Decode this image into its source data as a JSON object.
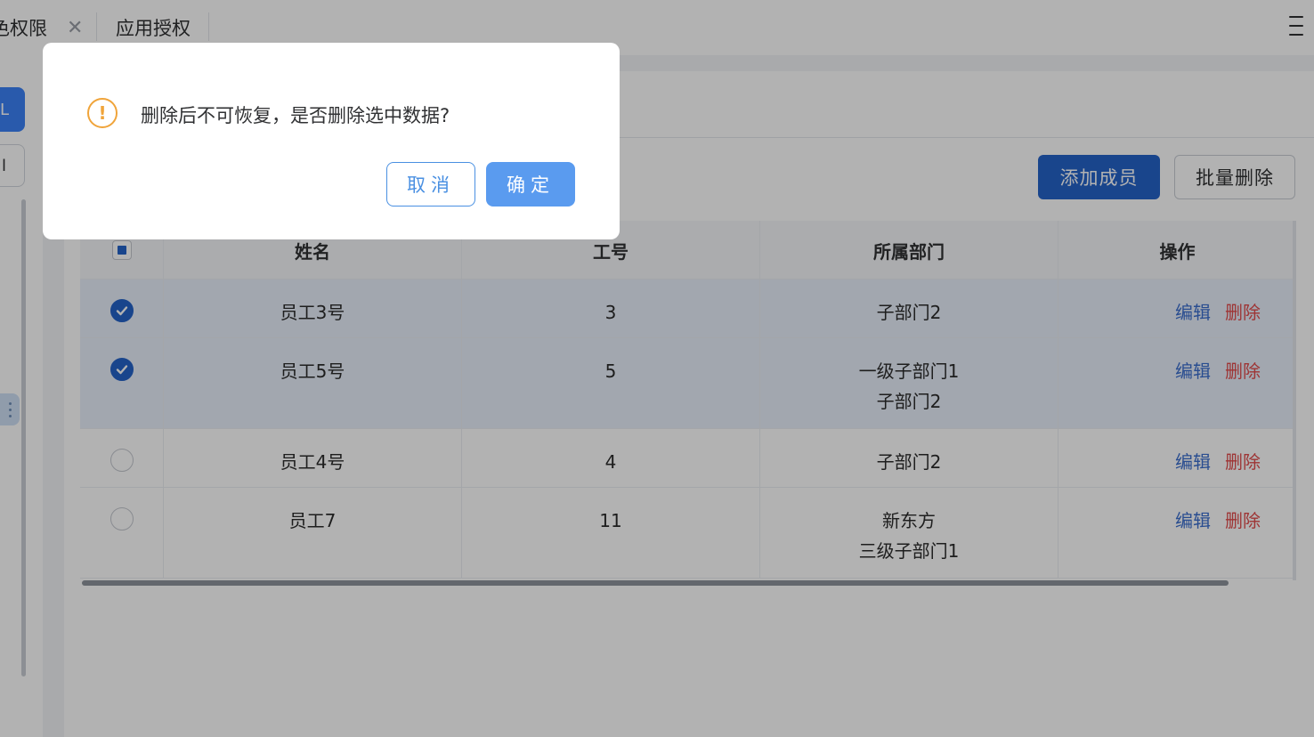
{
  "tabs": [
    {
      "label": "色权限",
      "closable": true
    },
    {
      "label": "应用授权",
      "closable": false
    }
  ],
  "icons": {
    "tab_close": "close-icon",
    "menu": "menu-icon",
    "warning": "warning-icon",
    "checkbox": "check-icon"
  },
  "sidebar": {
    "primary_btn_label": "L",
    "secondary_btn_label": "l"
  },
  "toolbar": {
    "add_member_label": "添加成员",
    "batch_delete_label": "批量删除"
  },
  "table": {
    "columns": [
      "姓名",
      "工号",
      "所属部门",
      "操作"
    ],
    "header_checkbox_state": "indeterminate",
    "rows": [
      {
        "checked": true,
        "name": "员工3号",
        "id": "3",
        "dept_lines": [
          "子部门2"
        ],
        "edit": "编辑",
        "delete": "删除"
      },
      {
        "checked": true,
        "name": "员工5号",
        "id": "5",
        "dept_lines": [
          "一级子部门1",
          "子部门2"
        ],
        "edit": "编辑",
        "delete": "删除"
      },
      {
        "checked": false,
        "name": "员工4号",
        "id": "4",
        "dept_lines": [
          "子部门2"
        ],
        "edit": "编辑",
        "delete": "删除"
      },
      {
        "checked": false,
        "name": "员工7",
        "id": "11",
        "dept_lines": [
          "新东方",
          "三级子部门1"
        ],
        "edit": "编辑",
        "delete": "删除"
      }
    ]
  },
  "dialog": {
    "message": "删除后不可恢复，是否删除选中数据?",
    "cancel_label": "取消",
    "confirm_label": "确定"
  },
  "colors": {
    "primary": "#2563c9",
    "delete": "#e24b4b",
    "warning": "#f0a43a"
  }
}
